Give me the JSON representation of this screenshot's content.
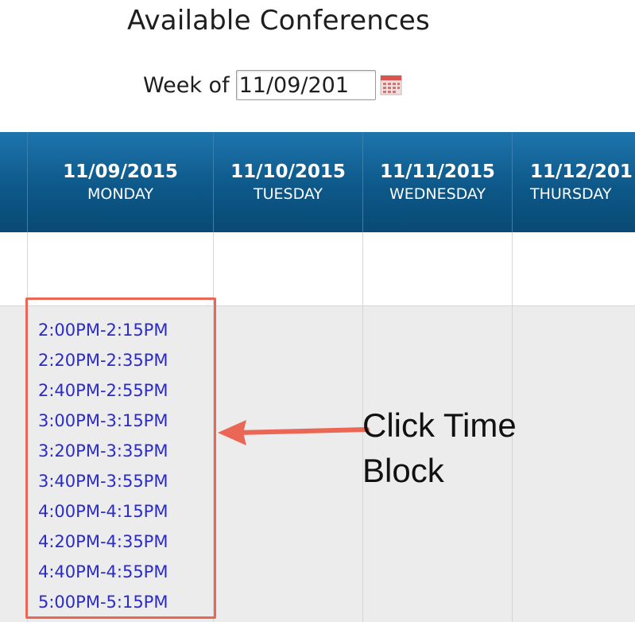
{
  "page": {
    "title": "Available Conferences",
    "week_label": "Week of",
    "week_value": "11/09/201"
  },
  "icons": {
    "calendar": "calendar-icon"
  },
  "days": [
    {
      "date": "11/09/2015",
      "weekday": "MONDAY"
    },
    {
      "date": "11/10/2015",
      "weekday": "TUESDAY"
    },
    {
      "date": "11/11/2015",
      "weekday": "WEDNESDAY"
    },
    {
      "date": "11/12/201",
      "weekday": "THURSDAY"
    }
  ],
  "monday_slots": [
    "2:00PM-2:15PM",
    "2:20PM-2:35PM",
    "2:40PM-2:55PM",
    "3:00PM-3:15PM",
    "3:20PM-3:35PM",
    "3:40PM-3:55PM",
    "4:00PM-4:15PM",
    "4:20PM-4:35PM",
    "4:40PM-4:55PM",
    "5:00PM-5:15PM"
  ],
  "annotation": {
    "text": "Click Time\nBlock"
  },
  "colors": {
    "header_top": "#1d75ad",
    "header_bottom": "#094a74",
    "slot_link": "#2b2bc8",
    "annotation_red": "#ea6655",
    "row_gray": "#ececec"
  }
}
